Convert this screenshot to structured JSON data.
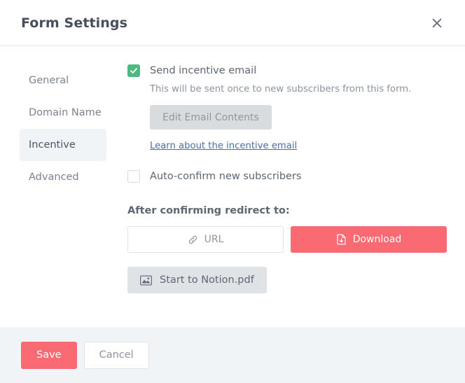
{
  "header": {
    "title": "Form Settings",
    "close_icon": "close-icon"
  },
  "sidebar": {
    "items": [
      {
        "label": "General",
        "active": false
      },
      {
        "label": "Domain Name",
        "active": false
      },
      {
        "label": "Incentive",
        "active": true
      },
      {
        "label": "Advanced",
        "active": false
      }
    ]
  },
  "main": {
    "incentive_email": {
      "checked": true,
      "label": "Send incentive email",
      "help_text": "This will be sent once to new subscribers from this form.",
      "edit_button_label": "Edit Email Contents",
      "learn_link_label": "Learn about the incentive email"
    },
    "auto_confirm": {
      "checked": false,
      "label": "Auto-confirm new subscribers"
    },
    "redirect": {
      "heading": "After confirming redirect to:",
      "options": [
        {
          "label": "URL",
          "icon": "link-icon",
          "active": false
        },
        {
          "label": "Download",
          "icon": "file-download-icon",
          "active": true
        }
      ],
      "attached_file": {
        "label": "Start to Notion.pdf",
        "icon": "image-icon"
      }
    }
  },
  "footer": {
    "save_label": "Save",
    "cancel_label": "Cancel"
  },
  "colors": {
    "accent_red": "#f96a72",
    "check_green": "#4cb97f",
    "link_blue": "#4a6fa8",
    "panel_gray": "#f1f4f7"
  }
}
